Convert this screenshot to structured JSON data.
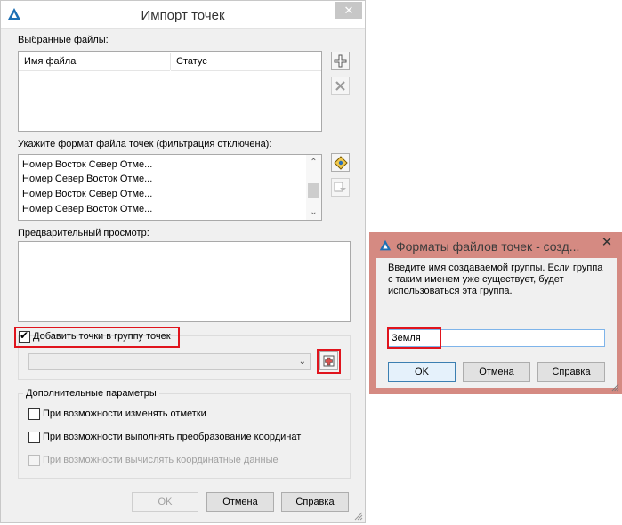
{
  "main": {
    "title": "Импорт точек",
    "close": "✕",
    "selected_files_label": "Выбранные файлы:",
    "columns": [
      "Имя файла",
      "Статус"
    ],
    "format_label": "Укажите формат файла точек (фильтрация отключена):",
    "formats": [
      "Номер Восток Север Отме...",
      "Номер Север Восток Отме...",
      "Номер Восток Север Отме...",
      "Номер Север Восток Отме..."
    ],
    "preview_label": "Предварительный просмотр:",
    "add_to_group_label": "Добавить точки в группу точек",
    "add_to_group_checked": true,
    "group_combo_value": "",
    "advanced_label": "Дополнительные параметры",
    "options": [
      {
        "label": "При возможности изменять отметки",
        "checked": false,
        "enabled": true
      },
      {
        "label": "При возможности выполнять преобразование координат",
        "checked": false,
        "enabled": true
      },
      {
        "label": "При возможности вычислять координатные данные",
        "checked": false,
        "enabled": false
      }
    ],
    "buttons": {
      "ok": "OK",
      "cancel": "Отмена",
      "help": "Справка"
    }
  },
  "secondary": {
    "title": "Форматы файлов точек - созд...",
    "close": "✕",
    "prompt": [
      "Введите имя создаваемой группы. Если группа",
      "с таким именем уже существует, будет",
      "использоваться эта группа."
    ],
    "name_value": "Земля",
    "buttons": {
      "ok": "OK",
      "cancel": "Отмена",
      "help": "Справка"
    }
  },
  "colors": {
    "highlight": "#e0141d",
    "accent": "#3c7fb1",
    "secondary_frame": "#d58a82"
  }
}
